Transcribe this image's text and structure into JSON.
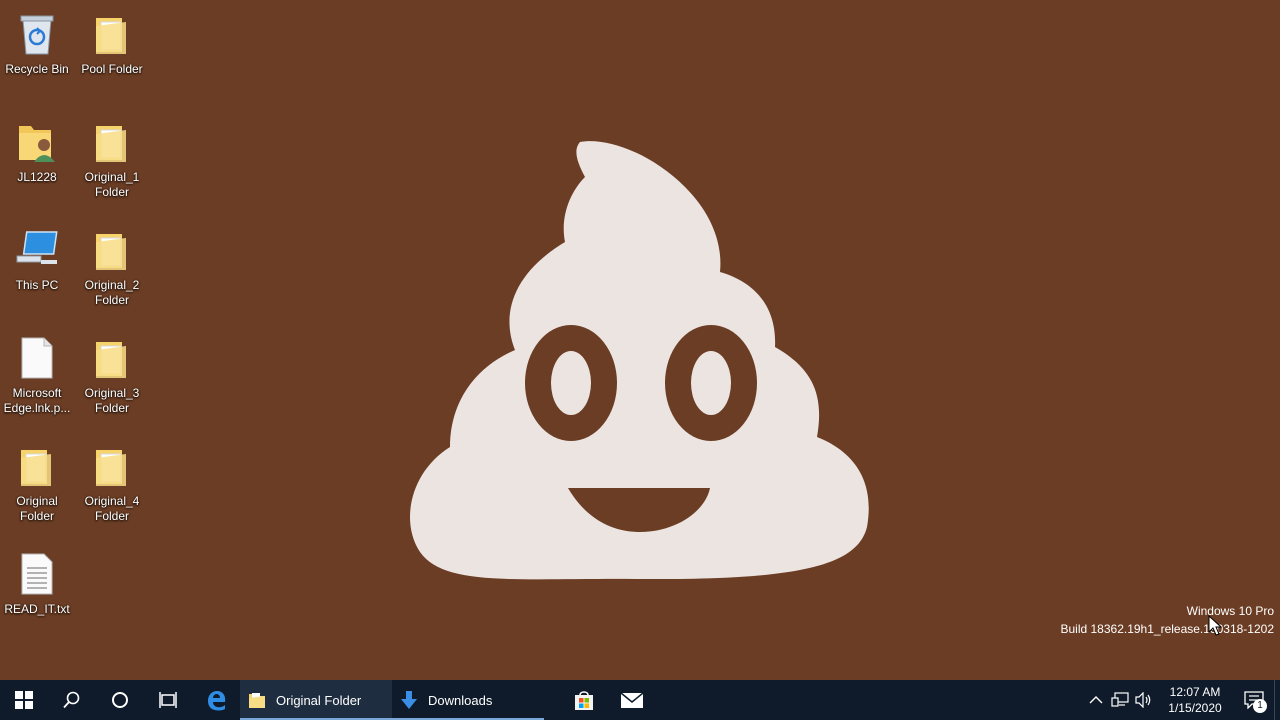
{
  "desktop": {
    "icons": [
      {
        "label": "Recycle Bin",
        "type": "recycle-bin"
      },
      {
        "label": "Pool Folder",
        "type": "folder"
      },
      {
        "label": "JL1228",
        "type": "user-folder"
      },
      {
        "label": "Original_1 Folder",
        "type": "folder"
      },
      {
        "label": "This PC",
        "type": "computer"
      },
      {
        "label": "Original_2 Folder",
        "type": "folder"
      },
      {
        "label": "Microsoft Edge.lnk.p...",
        "type": "blank-file"
      },
      {
        "label": "Original_3 Folder",
        "type": "folder"
      },
      {
        "label": "Original Folder",
        "type": "folder"
      },
      {
        "label": "Original_4 Folder",
        "type": "folder"
      },
      {
        "label": "READ_IT.txt",
        "type": "text-file"
      }
    ]
  },
  "wallpaper": {
    "subject": "poop-emoji-icon",
    "background_color": "#6b3d24",
    "shape_color": "#ece4e1"
  },
  "watermark": {
    "line1": "Windows 10 Pro",
    "line2": "Build 18362.19h1_release.190318-1202"
  },
  "taskbar": {
    "apps": [
      {
        "label": "Original Folder",
        "icon": "folder-icon"
      },
      {
        "label": "Downloads",
        "icon": "download-arrow-icon"
      }
    ],
    "clock": {
      "time": "12:07 AM",
      "date": "1/15/2020"
    },
    "notification_count": "1"
  },
  "colors": {
    "taskbar": "#0f1b2a",
    "desktop": "#6b3d24"
  }
}
